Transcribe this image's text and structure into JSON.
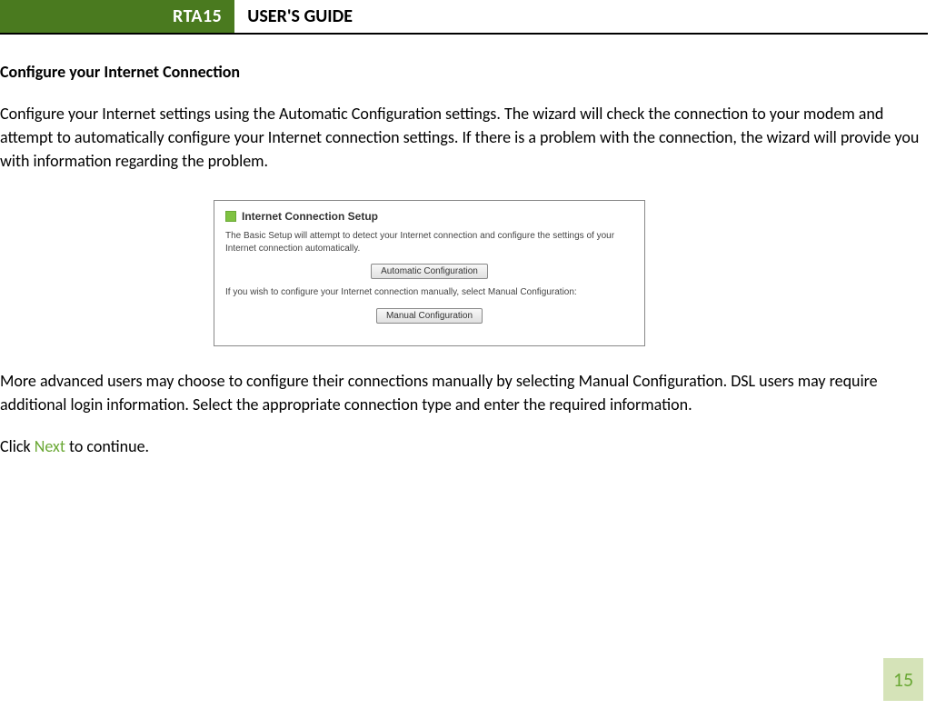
{
  "header": {
    "brand": "RTA15",
    "title": "USER'S GUIDE"
  },
  "section": {
    "heading": "Configure your Internet Connection",
    "para1": "Configure your Internet settings using the Automatic Configuration settings.  The wizard will check the connection to your modem and attempt to automatically configure your Internet connection settings.  If there is a problem with the connection, the wizard will provide you with information regarding the problem.",
    "para2": "More advanced users may choose to configure their connections manually by selecting Manual Configuration. DSL users may require additional login information.  Select the appropriate connection type and enter the required information.",
    "click_prefix": "Click ",
    "click_link": "Next",
    "click_suffix": " to continue."
  },
  "panel": {
    "title": "Internet Connection Setup",
    "text1": "The Basic Setup will attempt to detect your Internet connection and configure the settings of your Internet connection automatically.",
    "button1": "Automatic Configuration",
    "text2": "If you wish to configure your Internet connection manually, select Manual Configuration:",
    "button2": "Manual Configuration"
  },
  "page_number": "15"
}
